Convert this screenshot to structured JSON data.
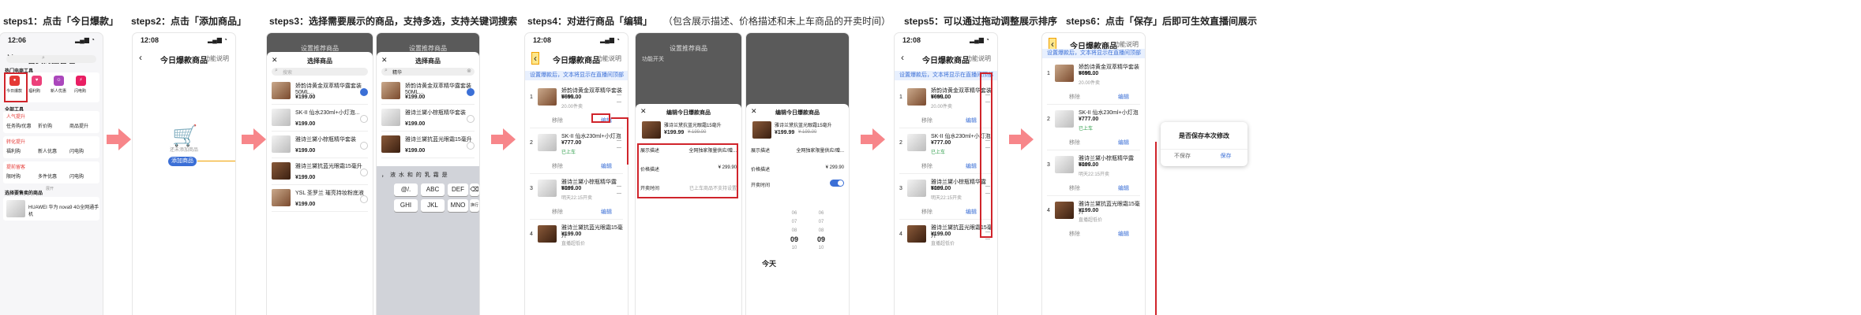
{
  "steps": {
    "s1": "steps1：点击「今日爆款」",
    "s2": "steps2：点击「添加商品」",
    "s3": "steps3：选择需要展示的商品，支持多选，支持关键词搜索",
    "s4": "steps4：对进行商品「编辑」",
    "s4_note": "（包含展示描述、价格描述和未上车商品的开卖时间）",
    "s5": "steps5：可以通过拖动调整展示排序",
    "s6": "steps6：点击「保存」后即可生效直播间展示"
  },
  "time": "12:06",
  "time2": "12:08",
  "p1": {
    "title": "售卖商品管理",
    "hot_tools": "热门电商工具",
    "tools": [
      "今日爆款",
      "福利购",
      "新人优惠",
      "闪电购"
    ],
    "all_tools": "全部工具",
    "sec_a": "人气提升",
    "a_items": [
      "任务购/优惠",
      "折价购",
      "商品提升"
    ],
    "sec_b": "转化提升",
    "b_items": [
      "福利购",
      "新人优惠",
      "闪电购"
    ],
    "sec_c": "提前留客",
    "c_items": [
      "限时购",
      "多件优惠",
      "闪电购"
    ],
    "more": "展开",
    "select_label": "选择要售卖的商品",
    "product": "HUAWEI 华为 nova9 4G全网通手机"
  },
  "p2": {
    "title": "今日爆款商品",
    "help": "功能说明",
    "empty": "还未添加商品",
    "add_btn": "添加商品"
  },
  "p3": {
    "bg_title": "设置推荐商品",
    "title": "选择商品",
    "search_ph": "搜索",
    "search_val": "精华",
    "products": [
      {
        "name": "娇韵诗黄金双萃精华露套装50ML...",
        "price": "¥199.00"
      },
      {
        "name": "SK-II 仙水230ml+小灯泡...",
        "price": "¥199.00"
      },
      {
        "name": "雅诗兰黛小棕瓶精华套装",
        "price": "¥199.00"
      },
      {
        "name": "雅诗兰黛抗蓝光眼霜15毫升",
        "price": "¥199.00"
      },
      {
        "name": "YSL 圣罗兰 璀亮持妆粉底液",
        "price": "¥199.00"
      }
    ],
    "keys_row0": "，  液  水  和  的  乳  霜  是",
    "keys": [
      "@/.",
      "ABC",
      "DEF",
      "GHI",
      "JKL",
      "MNO"
    ],
    "del": "⌫",
    "newline": "换行"
  },
  "p4": {
    "title": "今日爆款商品",
    "help": "功能说明",
    "banner": "设置爆款后，文本将显示在直播间顶部",
    "items": [
      {
        "idx": "1",
        "name": "娇韵诗黄金双萃精华套装50ML...",
        "price": "¥699.00",
        "sub": "20.00件卖"
      },
      {
        "idx": "2",
        "name": "SK-II 仙水230ml+小灯泡",
        "price": "¥777.00",
        "sub": "已上车"
      },
      {
        "idx": "3",
        "name": "雅诗兰黛小棕瓶精华露50ml...",
        "price": "¥199.00",
        "sub": "明天22:15开卖"
      },
      {
        "idx": "4",
        "name": "雅诗兰黛抗蓝光眼霜15毫升",
        "price": "¥199.00",
        "sub": "直播超低价"
      }
    ],
    "remove": "移除",
    "edit": "编辑",
    "switch_label": "功能开关",
    "dialog_title": "编辑今日爆款商品",
    "dialog_product": "雅诗兰黛抗蓝光眼霜15毫升",
    "dialog_price": "¥199.99",
    "dialog_old": "¥ 199.00",
    "f1_label": "展示描述",
    "f1_val": "全网独家限量供应/赠...",
    "f2_label": "价格描述",
    "f2_val": "¥ 299.90",
    "f3_label": "开卖时间",
    "f3_val": "已上车商品不支持设置",
    "picker_day": "今天",
    "picker_h": [
      "06",
      "07",
      "08",
      "09",
      "10"
    ],
    "picker_m": [
      "06",
      "07",
      "08",
      "09",
      "10"
    ]
  },
  "p6": {
    "modal_title": "是否保存本次修改",
    "nosave": "不保存",
    "save": "保存"
  }
}
